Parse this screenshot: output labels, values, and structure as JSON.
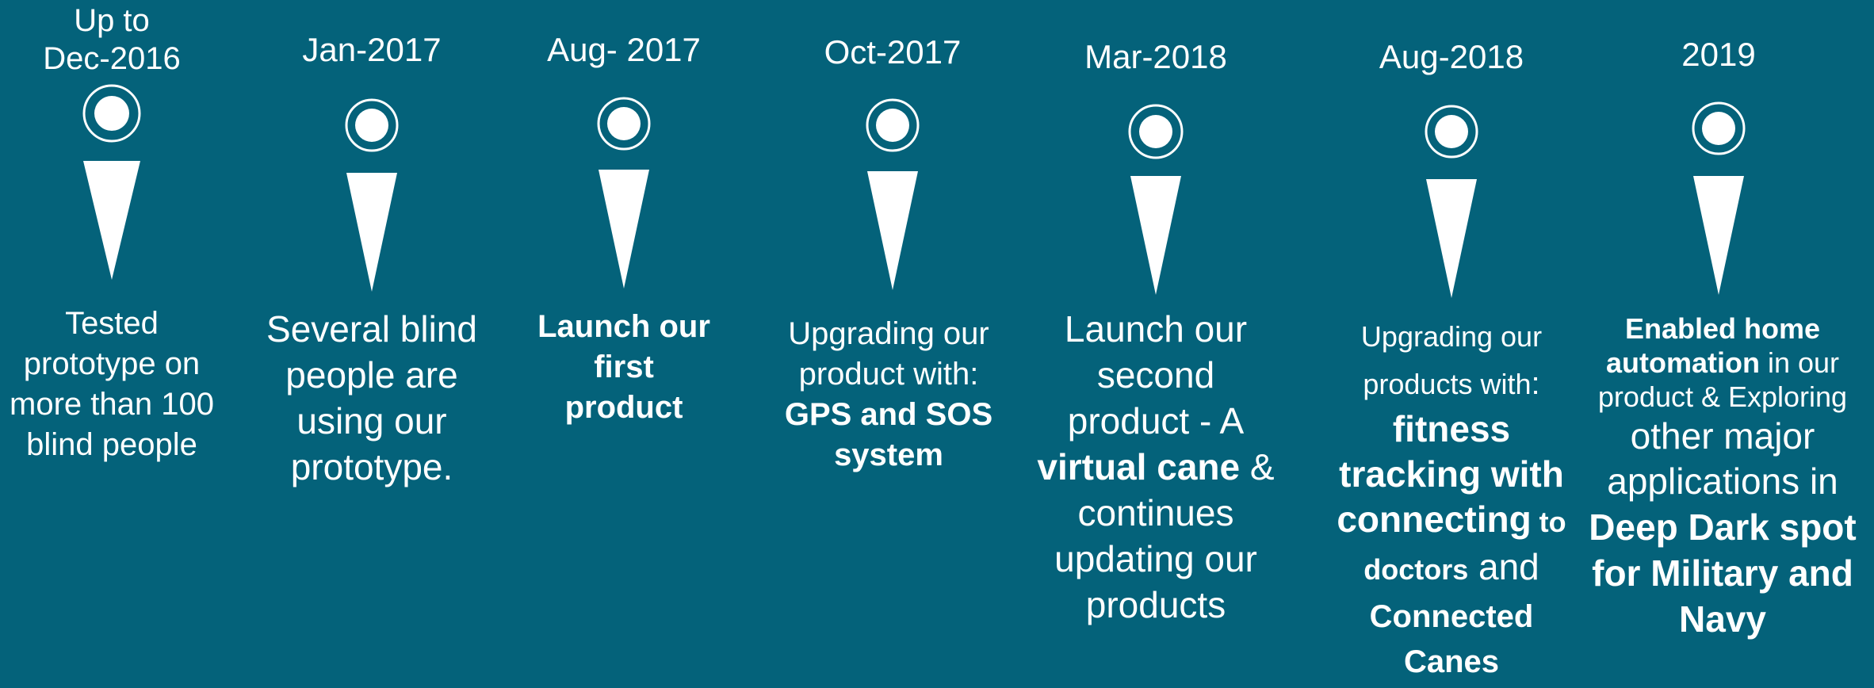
{
  "milestones": [
    {
      "date": "Up to\nDec-2016",
      "segments": [
        {
          "text": "Tested prototype on more than 100 blind people",
          "bold": false
        }
      ]
    },
    {
      "date": "Jan-2017",
      "segments": [
        {
          "text": "Several blind people are using our prototype.",
          "bold": false
        }
      ]
    },
    {
      "date": "Aug- 2017",
      "segments": [
        {
          "text": "Launch our first product",
          "bold": true
        }
      ]
    },
    {
      "date": "Oct-2017",
      "segments": [
        {
          "text": "Upgrading our product with: ",
          "bold": false
        },
        {
          "text": "GPS and SOS system",
          "bold": true
        }
      ]
    },
    {
      "date": "Mar-2018",
      "segments": [
        {
          "text": "Launch our second product - A ",
          "bold": false
        },
        {
          "text": "virtual cane",
          "bold": true
        },
        {
          "text": " & continues updating our products",
          "bold": false
        }
      ]
    },
    {
      "date": "Aug-2018",
      "segments": [
        {
          "text": "Upgrading our products with",
          "bold": false
        },
        {
          "text": ": ",
          "bold": false
        },
        {
          "text": "fitness tracking with connecting",
          "bold": true
        },
        {
          "text": " to doctors",
          "bold": true
        },
        {
          "text": " and ",
          "bold": false
        },
        {
          "text": "Connected Canes",
          "bold": true
        }
      ]
    },
    {
      "date": "2019",
      "segments": [
        {
          "text": "Enabled home automation",
          "bold": true
        },
        {
          "text": " in our product & Exploring ",
          "bold": false
        },
        {
          "text": "other major applications in ",
          "bold": false
        },
        {
          "text": "Deep Dark spot for Military and Navy",
          "bold": true
        }
      ]
    }
  ]
}
